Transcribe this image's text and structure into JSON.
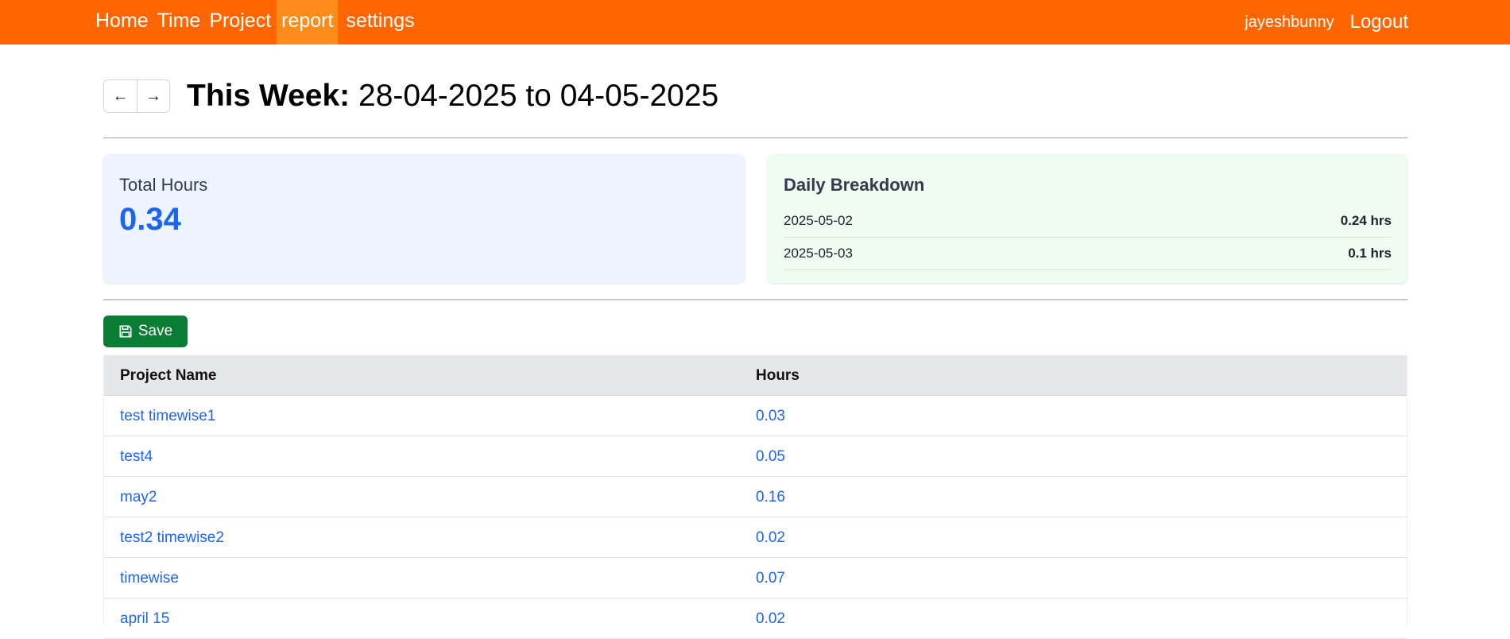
{
  "nav": {
    "items": [
      {
        "label": "Home",
        "active": false
      },
      {
        "label": "Time",
        "active": false
      },
      {
        "label": "Project",
        "active": false
      },
      {
        "label": "report",
        "active": true
      },
      {
        "label": "settings",
        "active": false
      }
    ],
    "username": "jayeshbunny",
    "logout": "Logout"
  },
  "header": {
    "prev_arrow": "←",
    "next_arrow": "→",
    "title_strong": "This Week:",
    "range": "28-04-2025 to 04-05-2025"
  },
  "total": {
    "label": "Total Hours",
    "value": "0.34"
  },
  "daily": {
    "heading": "Daily Breakdown",
    "rows": [
      {
        "date": "2025-05-02",
        "hours": "0.24 hrs"
      },
      {
        "date": "2025-05-03",
        "hours": "0.1 hrs"
      }
    ]
  },
  "save_label": "Save",
  "table": {
    "columns": [
      "Project Name",
      "Hours"
    ],
    "rows": [
      {
        "name": "test timewise1",
        "hours": "0.03"
      },
      {
        "name": "test4",
        "hours": "0.05"
      },
      {
        "name": "may2",
        "hours": "0.16"
      },
      {
        "name": "test2 timewise2",
        "hours": "0.02"
      },
      {
        "name": "timewise",
        "hours": "0.07"
      },
      {
        "name": "april 15",
        "hours": "0.02"
      }
    ]
  },
  "colors": {
    "navbar": "#ff6600",
    "nav_active": "#ff8c1a",
    "accent_blue": "#1c64f2",
    "save_green": "#0a7d35",
    "total_card_bg": "#edf4ff",
    "daily_card_bg": "#eefcf2"
  }
}
